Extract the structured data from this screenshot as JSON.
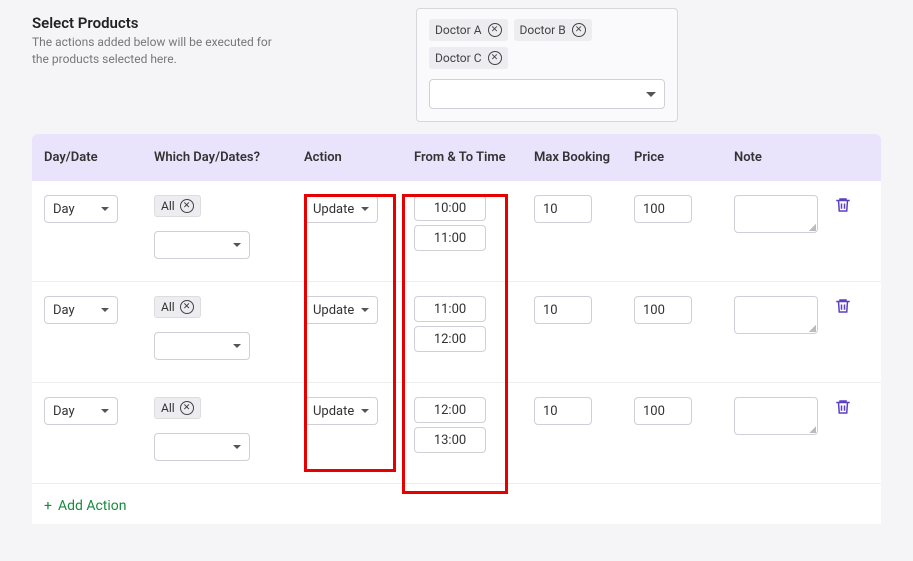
{
  "header": {
    "title": "Select Products",
    "subtitle": "The actions added below will be executed for the products selected here."
  },
  "products": {
    "chips": [
      "Doctor A",
      "Doctor B",
      "Doctor C"
    ]
  },
  "columns": {
    "daydate": "Day/Date",
    "which": "Which Day/Dates?",
    "action": "Action",
    "time": "From & To Time",
    "max": "Max Booking",
    "price": "Price",
    "note": "Note"
  },
  "rows": [
    {
      "daydate": "Day",
      "which_tag": "All",
      "action": "Update",
      "from": "10:00",
      "to": "11:00",
      "max": "10",
      "price": "100"
    },
    {
      "daydate": "Day",
      "which_tag": "All",
      "action": "Update",
      "from": "11:00",
      "to": "12:00",
      "max": "10",
      "price": "100"
    },
    {
      "daydate": "Day",
      "which_tag": "All",
      "action": "Update",
      "from": "12:00",
      "to": "13:00",
      "max": "10",
      "price": "100"
    }
  ],
  "footer": {
    "add_action": "Add Action",
    "plus": "+"
  }
}
